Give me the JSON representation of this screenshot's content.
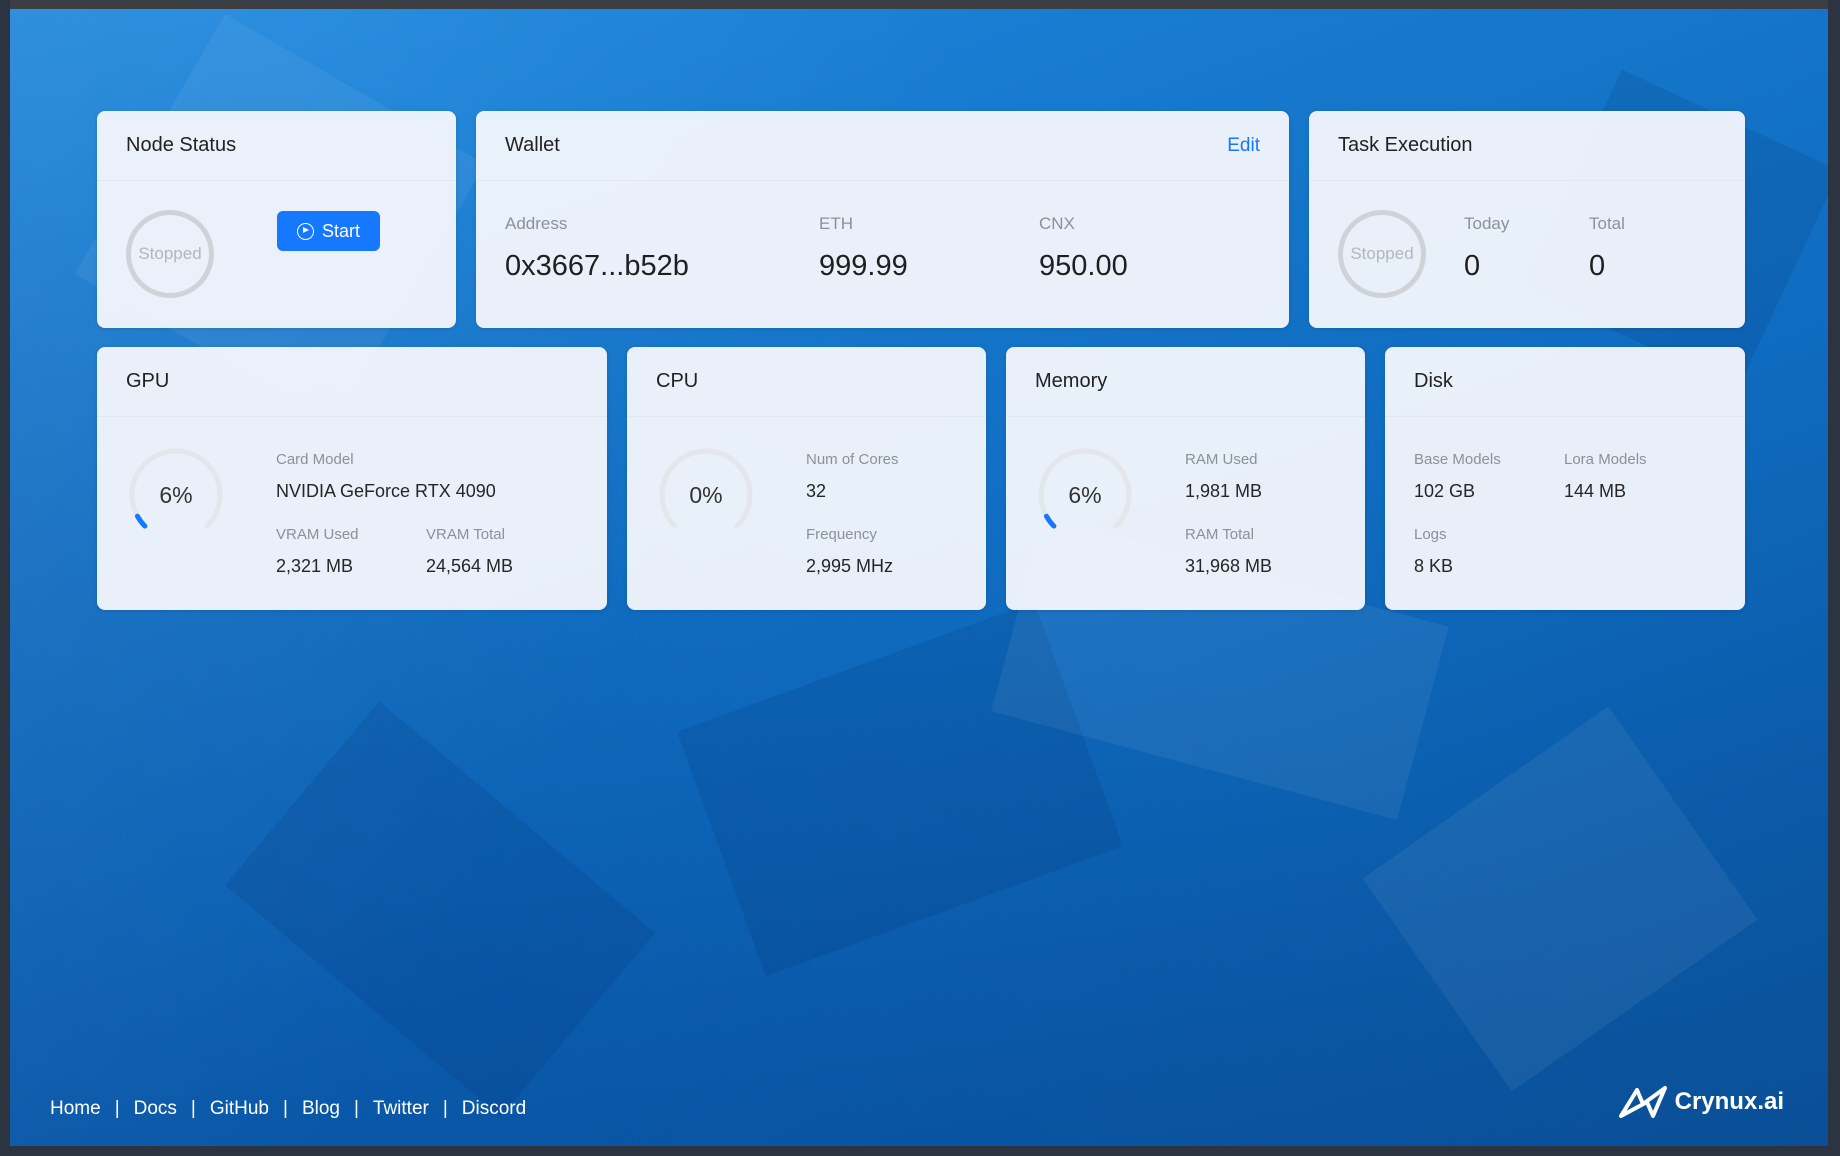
{
  "node_status": {
    "title": "Node Status",
    "status": "Stopped",
    "start_label": "Start"
  },
  "wallet": {
    "title": "Wallet",
    "edit_label": "Edit",
    "address_label": "Address",
    "address": "0x3667...b52b",
    "eth_label": "ETH",
    "eth": "999.99",
    "cnx_label": "CNX",
    "cnx": "950.00"
  },
  "task_execution": {
    "title": "Task Execution",
    "status": "Stopped",
    "today_label": "Today",
    "today": "0",
    "total_label": "Total",
    "total": "0"
  },
  "gpu": {
    "title": "GPU",
    "usage_text": "6%",
    "usage_percent": 6,
    "card_model_label": "Card Model",
    "card_model": "NVIDIA GeForce RTX 4090",
    "vram_used_label": "VRAM Used",
    "vram_used": "2,321 MB",
    "vram_total_label": "VRAM Total",
    "vram_total": "24,564 MB"
  },
  "cpu": {
    "title": "CPU",
    "usage_text": "0%",
    "usage_percent": 0,
    "cores_label": "Num of Cores",
    "cores": "32",
    "frequency_label": "Frequency",
    "frequency": "2,995 MHz"
  },
  "memory": {
    "title": "Memory",
    "usage_text": "6%",
    "usage_percent": 6,
    "ram_used_label": "RAM Used",
    "ram_used": "1,981 MB",
    "ram_total_label": "RAM Total",
    "ram_total": "31,968 MB"
  },
  "disk": {
    "title": "Disk",
    "base_models_label": "Base Models",
    "base_models": "102 GB",
    "lora_models_label": "Lora Models",
    "lora_models": "144 MB",
    "logs_label": "Logs",
    "logs": "8 KB"
  },
  "footer": {
    "links": [
      "Home",
      "Docs",
      "GitHub",
      "Blog",
      "Twitter",
      "Discord"
    ],
    "brand": "Crynux.ai"
  },
  "colors": {
    "accent": "#1677ff",
    "gauge_track": "#e3e6ea"
  }
}
